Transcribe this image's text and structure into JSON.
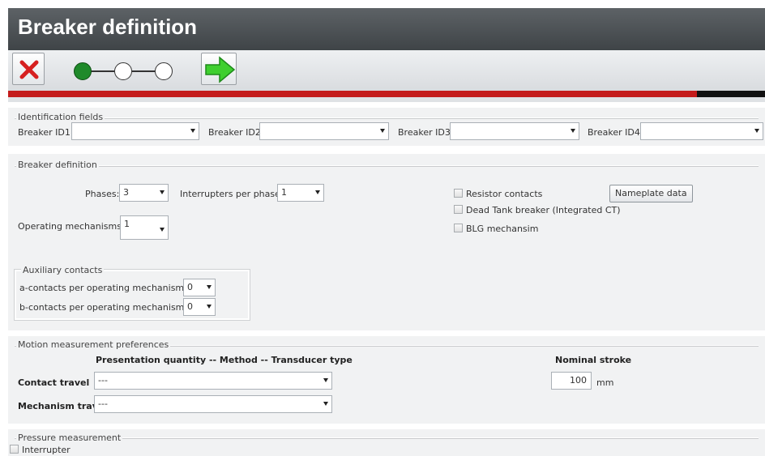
{
  "header": {
    "title": "Breaker definition"
  },
  "toolbar": {
    "cancel_icon": "red-x-icon",
    "next_icon": "green-arrow-right-icon",
    "wizard_steps": [
      {
        "state": "active"
      },
      {
        "state": "inactive"
      },
      {
        "state": "inactive"
      }
    ],
    "progress_fraction": 0.91
  },
  "identification": {
    "legend": "Identification fields",
    "fields": [
      {
        "label": "Breaker ID1",
        "value": ""
      },
      {
        "label": "Breaker ID2",
        "value": ""
      },
      {
        "label": "Breaker ID3",
        "value": ""
      },
      {
        "label": "Breaker ID4",
        "value": ""
      }
    ]
  },
  "breaker": {
    "legend": "Breaker definition",
    "phases_label": "Phases:",
    "phases_value": "3",
    "interrupters_label": "Interrupters per phase",
    "interrupters_value": "1",
    "mechanisms_label": "Operating mechanisms:",
    "mechanisms_value": "1",
    "resistor_label": "Resistor contacts",
    "dead_tank_label": "Dead Tank breaker (Integrated CT)",
    "blg_label": "BLG mechansim",
    "nameplate_button": "Nameplate data",
    "aux": {
      "legend": "Auxiliary contacts",
      "a_label": "a-contacts per operating mechanism:",
      "a_value": "0",
      "b_label": "b-contacts per operating mechanism:",
      "b_value": "0"
    }
  },
  "motion": {
    "legend": "Motion measurement preferences",
    "column_header": "Presentation quantity -- Method -- Transducer type",
    "stroke_header": "Nominal stroke",
    "contact_label": "Contact travel",
    "contact_value": "---",
    "mechanism_label": "Mechanism trav",
    "mechanism_value": "---",
    "stroke_value": "100",
    "stroke_unit": "mm"
  },
  "pressure": {
    "legend": "Pressure measurement",
    "interrupter_label": "Interrupter"
  },
  "colors": {
    "header_bg": "#4a4f53",
    "progress_fill": "#c41b1b",
    "step_active": "#1f8a2a",
    "next_arrow": "#3fcf2f",
    "cancel_x": "#d62020"
  }
}
